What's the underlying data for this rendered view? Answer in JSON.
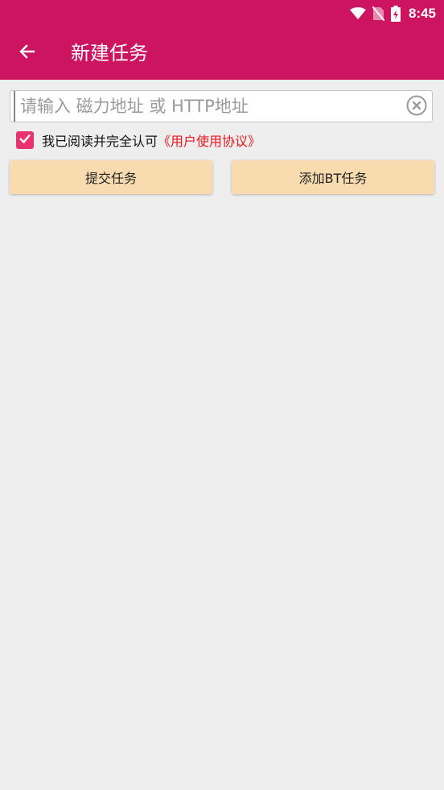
{
  "status_bar": {
    "time": "8:45",
    "icons": [
      "wifi-icon",
      "no-sim-icon",
      "battery-charging-icon"
    ]
  },
  "app_bar": {
    "title": "新建任务",
    "back_icon": "arrow-left-icon"
  },
  "url_input": {
    "value": "",
    "placeholder": "请输入 磁力地址 或 HTTP地址",
    "clear_icon": "clear-circle-icon"
  },
  "agreement": {
    "checked": true,
    "text": "我已阅读并完全认可",
    "link_text": "《用户使用协议》"
  },
  "buttons": {
    "submit_label": "提交任务",
    "add_bt_label": "添加BT任务"
  },
  "colors": {
    "primary": "#cc1460",
    "accent": "#e8336d",
    "link": "#e8151b",
    "button_bg": "#f9dbb0",
    "background": "#eeeeee"
  }
}
